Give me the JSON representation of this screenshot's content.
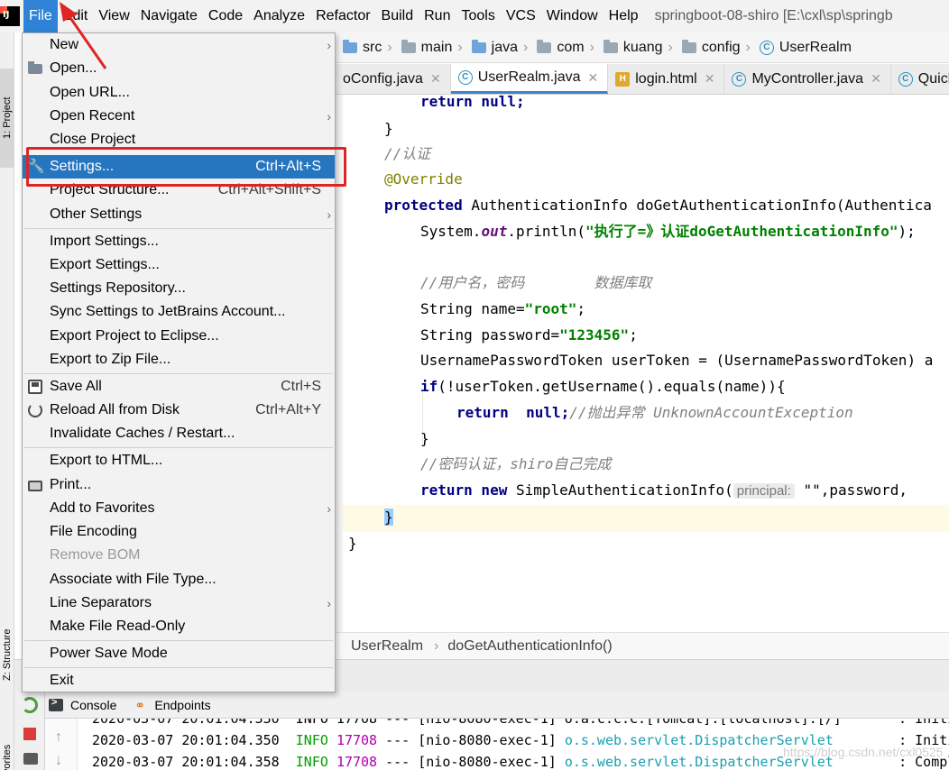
{
  "menubar": {
    "items": [
      "File",
      "Edit",
      "View",
      "Navigate",
      "Code",
      "Analyze",
      "Refactor",
      "Build",
      "Run",
      "Tools",
      "VCS",
      "Window",
      "Help"
    ],
    "title": "springboot-08-shiro [E:\\cxl\\sp\\springb"
  },
  "side_tabs": {
    "project": "1: Project",
    "structure": "Z: Structure",
    "favorites": "Favorites"
  },
  "navbar": {
    "crumbs": [
      "src",
      "main",
      "java",
      "com",
      "kuang",
      "config",
      "UserRealm"
    ]
  },
  "tabs": [
    {
      "label": "oConfig.java",
      "icon": "class-icon"
    },
    {
      "label": "UserRealm.java",
      "icon": "class-icon"
    },
    {
      "label": "login.html",
      "icon": "html-icon"
    },
    {
      "label": "MyController.java",
      "icon": "class-icon"
    },
    {
      "label": "Quicks",
      "icon": "class-icon"
    }
  ],
  "code": {
    "l1_return": "return",
    "l1_null": " null;",
    "l2": "}",
    "l3": "//认证",
    "l4": "@Override",
    "l5_kw": "protected",
    "l5_rest": " AuthenticationInfo doGetAuthenticationInfo(Authentica",
    "l6_a": "System.",
    "l6_out": "out",
    "l6_b": ".println(",
    "l6_str": "\"执行了=》认证doGetAuthenticationInfo\"",
    "l6_c": ");",
    "l7": "//用户名，密码        数据库取",
    "l8_a": "String name=",
    "l8_str": "\"root\"",
    "l8_b": ";",
    "l9_a": "String password=",
    "l9_str": "\"123456\"",
    "l9_b": ";",
    "l10": "UsernamePasswordToken userToken = (UsernamePasswordToken) a",
    "l11_kw": "if",
    "l11_rest": "(!userToken.getUsername().equals(name)){",
    "l12_return": "return",
    "l12_null": "  null;",
    "l12_cm": "//抛出异常 UnknownAccountException",
    "l13": "}",
    "l14": "//密码认证，shiro自己完成",
    "l15_return": "return",
    "l15_new": " new",
    "l15_a": " SimpleAuthenticationInfo(",
    "l15_hint": "principal:",
    "l15_b": " \"\",password,",
    "l16": "}",
    "l17": "}"
  },
  "editor_crumbs": [
    "UserRealm",
    "doGetAuthenticationInfo()"
  ],
  "run": {
    "tab_console": "Console",
    "tab_endpoints": "Endpoints",
    "log_top_partial": "2020-03-07 20:01:04.330  INFO 17708 --- [nio-8080-exec-1] o.a.c.c.C.[Tomcat].[localhost].[/]       : Initi",
    "log": [
      {
        "ts": "2020-03-07 20:01:04.350",
        "level": "INFO",
        "pid": "17708",
        "sep": " --- ",
        "thread": "[nio-8080-exec-1]",
        "logger": "o.s.web.servlet.DispatcherServlet",
        "msg": "        : Initi"
      },
      {
        "ts": "2020-03-07 20:01:04.358",
        "level": "INFO",
        "pid": "17708",
        "sep": " --- ",
        "thread": "[nio-8080-exec-1]",
        "logger": "o.s.web.servlet.DispatcherServlet",
        "msg": "        : Compl"
      }
    ],
    "watermark": "https://blog.csdn.net/cxl0525"
  },
  "file_menu": {
    "new": "New",
    "open": "Open...",
    "open_url": "Open URL...",
    "open_recent": "Open Recent",
    "close_project": "Close Project",
    "settings": "Settings...",
    "settings_shortcut": "Ctrl+Alt+S",
    "project_structure": "Project Structure...",
    "project_structure_shortcut": "Ctrl+Alt+Shift+S",
    "other_settings": "Other Settings",
    "import_settings": "Import Settings...",
    "export_settings": "Export Settings...",
    "settings_repository": "Settings Repository...",
    "sync_settings": "Sync Settings to JetBrains Account...",
    "export_eclipse": "Export Project to Eclipse...",
    "export_zip": "Export to Zip File...",
    "save_all": "Save All",
    "save_all_shortcut": "Ctrl+S",
    "reload_disk": "Reload All from Disk",
    "reload_disk_shortcut": "Ctrl+Alt+Y",
    "invalidate_caches": "Invalidate Caches / Restart...",
    "export_html": "Export to HTML...",
    "print": "Print...",
    "add_favorites": "Add to Favorites",
    "file_encoding": "File Encoding",
    "remove_bom": "Remove BOM",
    "associate_file_type": "Associate with File Type...",
    "line_separators": "Line Separators",
    "make_read_only": "Make File Read-Only",
    "power_save": "Power Save Mode",
    "exit": "Exit",
    "submenu_arrow": "›"
  },
  "colors": {
    "menu_selection": "#2675bf",
    "annotation_red": "#e02424",
    "keyword": "#000080",
    "string": "#008000",
    "comment": "#808080"
  }
}
